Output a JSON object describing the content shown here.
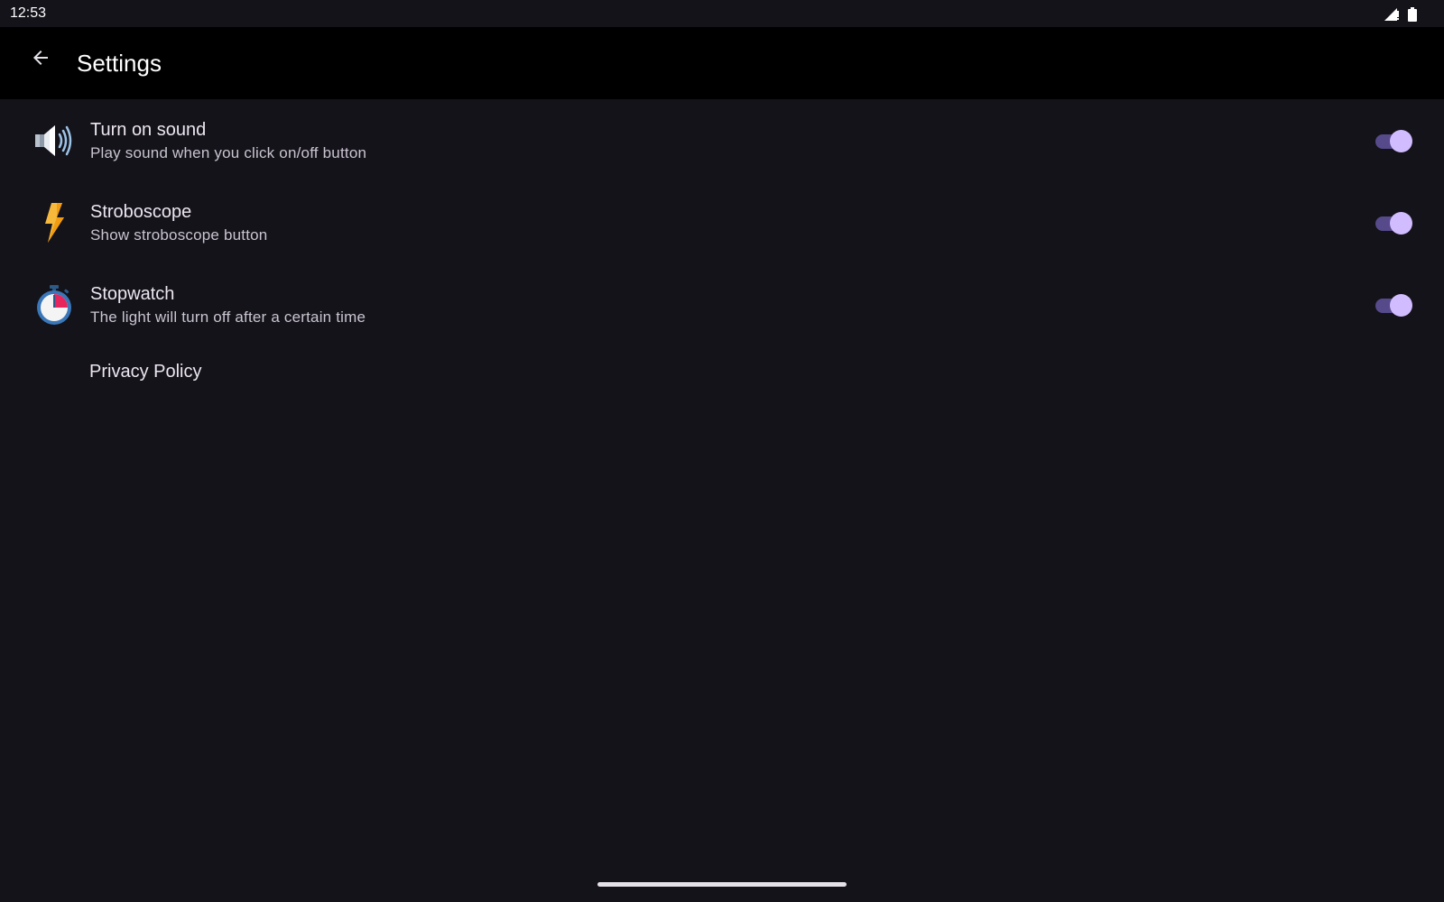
{
  "status_bar": {
    "time": "12:53",
    "icons": [
      "signal-icon",
      "battery-icon"
    ]
  },
  "app_bar": {
    "title": "Settings",
    "back_icon": "arrow-back-icon"
  },
  "settings": [
    {
      "id": "sound",
      "icon": "speaker-icon",
      "title": "Turn on sound",
      "subtitle": "Play sound when you click on/off button",
      "enabled": true
    },
    {
      "id": "stroboscope",
      "icon": "lightning-bolt-icon",
      "title": "Stroboscope",
      "subtitle": "Show stroboscope button",
      "enabled": true
    },
    {
      "id": "stopwatch",
      "icon": "stopwatch-icon",
      "title": "Stopwatch",
      "subtitle": "The light will turn off after a certain time",
      "enabled": true
    }
  ],
  "privacy_policy": {
    "label": "Privacy Policy"
  },
  "colors": {
    "background": "#14131a",
    "app_bar": "#000000",
    "switch_track": "#574a8a",
    "switch_thumb": "#d0bcff"
  }
}
